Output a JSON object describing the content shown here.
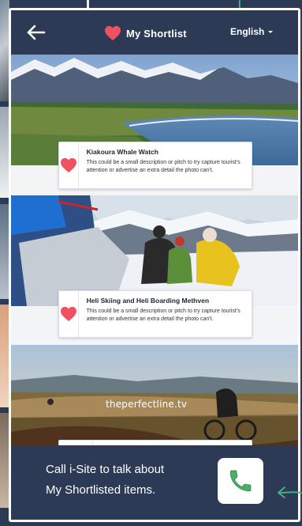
{
  "header": {
    "back_icon": "arrow-left-icon",
    "heart_icon": "heart-icon",
    "title": "My Shortlist",
    "language": "English"
  },
  "items": [
    {
      "name": "Kiakoura Whale Watch",
      "description": "This could be a small description or pitch to try capture tourist's attention or advertise an extra detail the photo can't.",
      "photo": "mountain-coast-photo"
    },
    {
      "name": "Heli Skiing and Heli Boarding Methven",
      "description": "This could be a small description or pitch to try capture tourist's attention or advertise an extra detail the photo can't.",
      "photo": "heli-skiing-photo"
    },
    {
      "name": "",
      "description": "",
      "photo": "mountain-biking-photo",
      "watermark": "theperfectline.tv"
    }
  ],
  "footer": {
    "line1": "Call i-Site to talk about",
    "line2": "My Shortlisted items.",
    "call_icon": "phone-icon"
  },
  "colors": {
    "navy": "#2d3a56",
    "heart": "#f0505f",
    "phone": "#49b068",
    "annotation_arrow": "#3fb27f"
  }
}
